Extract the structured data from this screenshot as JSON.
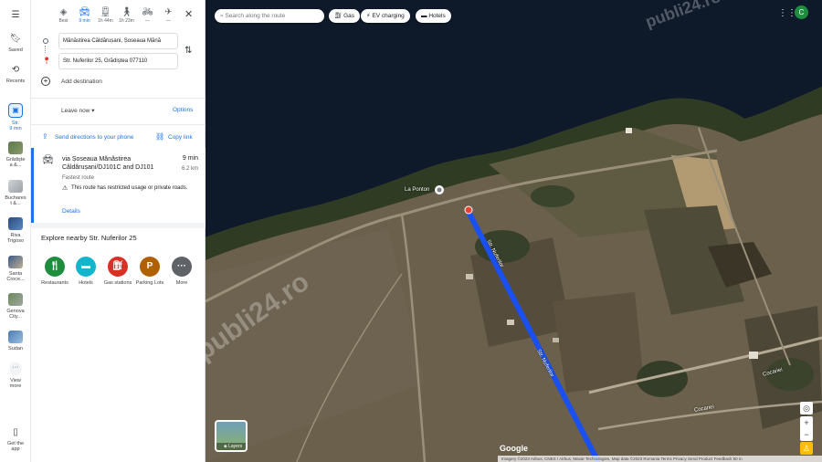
{
  "rail": {
    "menu_icon": "menu-icon",
    "items": [
      {
        "label": "Saved"
      },
      {
        "label": "Recents"
      },
      {
        "label": "Str.",
        "sub": "9 min"
      },
      {
        "label": "Grădiște",
        "sub": "a &..."
      },
      {
        "label": "Buchares",
        "sub": "t &..."
      },
      {
        "label": "Riva",
        "sub": "Trigoso"
      },
      {
        "label": "Santa",
        "sub": "Croce..."
      },
      {
        "label": "Genova",
        "sub": "City..."
      },
      {
        "label": "Sudan"
      },
      {
        "label": "View",
        "sub": "more"
      },
      {
        "label": "Get the",
        "sub": "app"
      }
    ]
  },
  "modes": [
    {
      "label": "Best",
      "icon": "diamond-icon"
    },
    {
      "label": "9 min",
      "icon": "car-icon",
      "active": true
    },
    {
      "label": "1h 44m",
      "icon": "transit-icon"
    },
    {
      "label": "1h 23m",
      "icon": "walk-icon"
    },
    {
      "label": "—",
      "icon": "bike-icon"
    },
    {
      "label": "—",
      "icon": "flight-icon"
    }
  ],
  "origin": "Mănăstirea Căldărușani, Șoseaua Mănă",
  "destination": "Str. Nuferilor 25, Grădiștea 077110",
  "add_destination": "Add destination",
  "leave_now": "Leave now",
  "options": "Options",
  "send_directions": "Send directions to your phone",
  "copy_link": "Copy link",
  "route": {
    "title": "via Șoseaua Mănăstirea Căldărușani/DJ101C and DJ101",
    "time": "9 min",
    "distance": "6.2 km",
    "fastest": "Fastest route",
    "warning": "This route has restricted usage or private roads.",
    "details": "Details"
  },
  "explore_title": "Explore nearby Str. Nuferilor 25",
  "categories": [
    {
      "label": "Restaurants",
      "icon": "fork-knife-icon",
      "color": "#1e8e3e"
    },
    {
      "label": "Hotels",
      "icon": "bed-icon",
      "color": "#12b5cb"
    },
    {
      "label": "Gas stations",
      "icon": "gas-icon",
      "color": "#d93025"
    },
    {
      "label": "Parking Lots",
      "icon": "parking-icon",
      "color": "#b06000"
    },
    {
      "label": "More",
      "icon": "more-icon",
      "color": "#5f6368"
    }
  ],
  "map": {
    "search_placeholder": "Search along the route",
    "chips": [
      "Gas",
      "EV charging",
      "Hotels"
    ],
    "avatar_letter": "C",
    "place_label": "La Ponton",
    "street_label": "Str. Nuferilor",
    "street_label2": "Cocariei",
    "layers_label": "Layers",
    "google_logo": "Google",
    "footer": "Imagery ©2023 Airbus, CNES / Airbus, Maxar Technologies, Map data ©2023   Romania   Terms   Privacy   Send Product Feedback   50 m",
    "watermark": "publi24.ro",
    "route_color": "#1a4ff0",
    "water_color": "#0e1a2a"
  }
}
